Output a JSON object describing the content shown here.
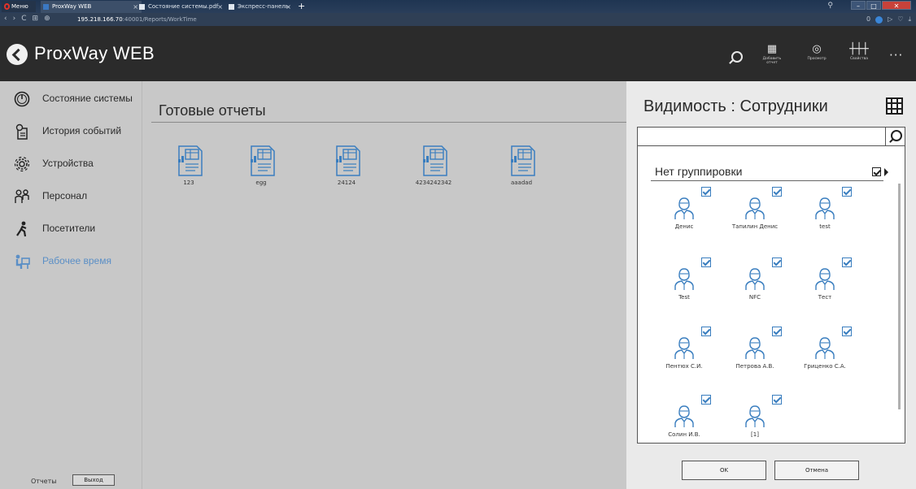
{
  "browser": {
    "menu_label": "Меню",
    "tabs": [
      {
        "label": "ProxWay WEB",
        "close": "×"
      },
      {
        "label": "Состояние системы.pdf",
        "close": "×"
      },
      {
        "label": "Экспресс-панель",
        "close": "×"
      }
    ],
    "new_tab": "+",
    "url_host": "195.218.166.70",
    "url_path": ":40001/Reports/WorkTime",
    "badge_count": "0"
  },
  "header": {
    "title": "ProxWay WEB",
    "tools": [
      {
        "label": "Добавить отчет",
        "icon": "add-report-icon"
      },
      {
        "label": "Просмотр",
        "icon": "eye-icon"
      },
      {
        "label": "Свойства",
        "icon": "sliders-icon"
      }
    ],
    "more": "···"
  },
  "sidebar": {
    "items": [
      {
        "label": "Состояние системы",
        "icon": "gauge-icon",
        "active": false
      },
      {
        "label": "История событий",
        "icon": "history-icon",
        "active": false
      },
      {
        "label": "Устройства",
        "icon": "gear-icon",
        "active": false
      },
      {
        "label": "Персонал",
        "icon": "staff-icon",
        "active": false
      },
      {
        "label": "Посетители",
        "icon": "visitor-icon",
        "active": false
      },
      {
        "label": "Рабочее время",
        "icon": "worktime-icon",
        "active": true
      }
    ],
    "footer_label": "Отчеты",
    "exit_button": "Выход"
  },
  "main": {
    "title": "Готовые отчеты",
    "reports": [
      "123",
      "egg",
      "24124",
      "4234242342",
      "aaadad"
    ]
  },
  "panel": {
    "title": "Видимость : Сотрудники",
    "search_value": "",
    "group_title": "Нет группировки",
    "people": [
      {
        "name": "Денис"
      },
      {
        "name": "Тапилин Денис"
      },
      {
        "name": "test"
      },
      {
        "name": "Test"
      },
      {
        "name": "NFC"
      },
      {
        "name": "Тест"
      },
      {
        "name": "Пентюх С.И."
      },
      {
        "name": "Петрова А.В."
      },
      {
        "name": "Гриценко С.А."
      },
      {
        "name": "Солин И.В."
      },
      {
        "name": "[1]"
      }
    ],
    "ok_button": "OK",
    "cancel_button": "Отмена"
  },
  "colors": {
    "accent": "#3a7ebf",
    "header_bg": "#2b2b2b",
    "sidebar_bg": "#c8c8c8",
    "active_nav": "#5b8fc6"
  }
}
